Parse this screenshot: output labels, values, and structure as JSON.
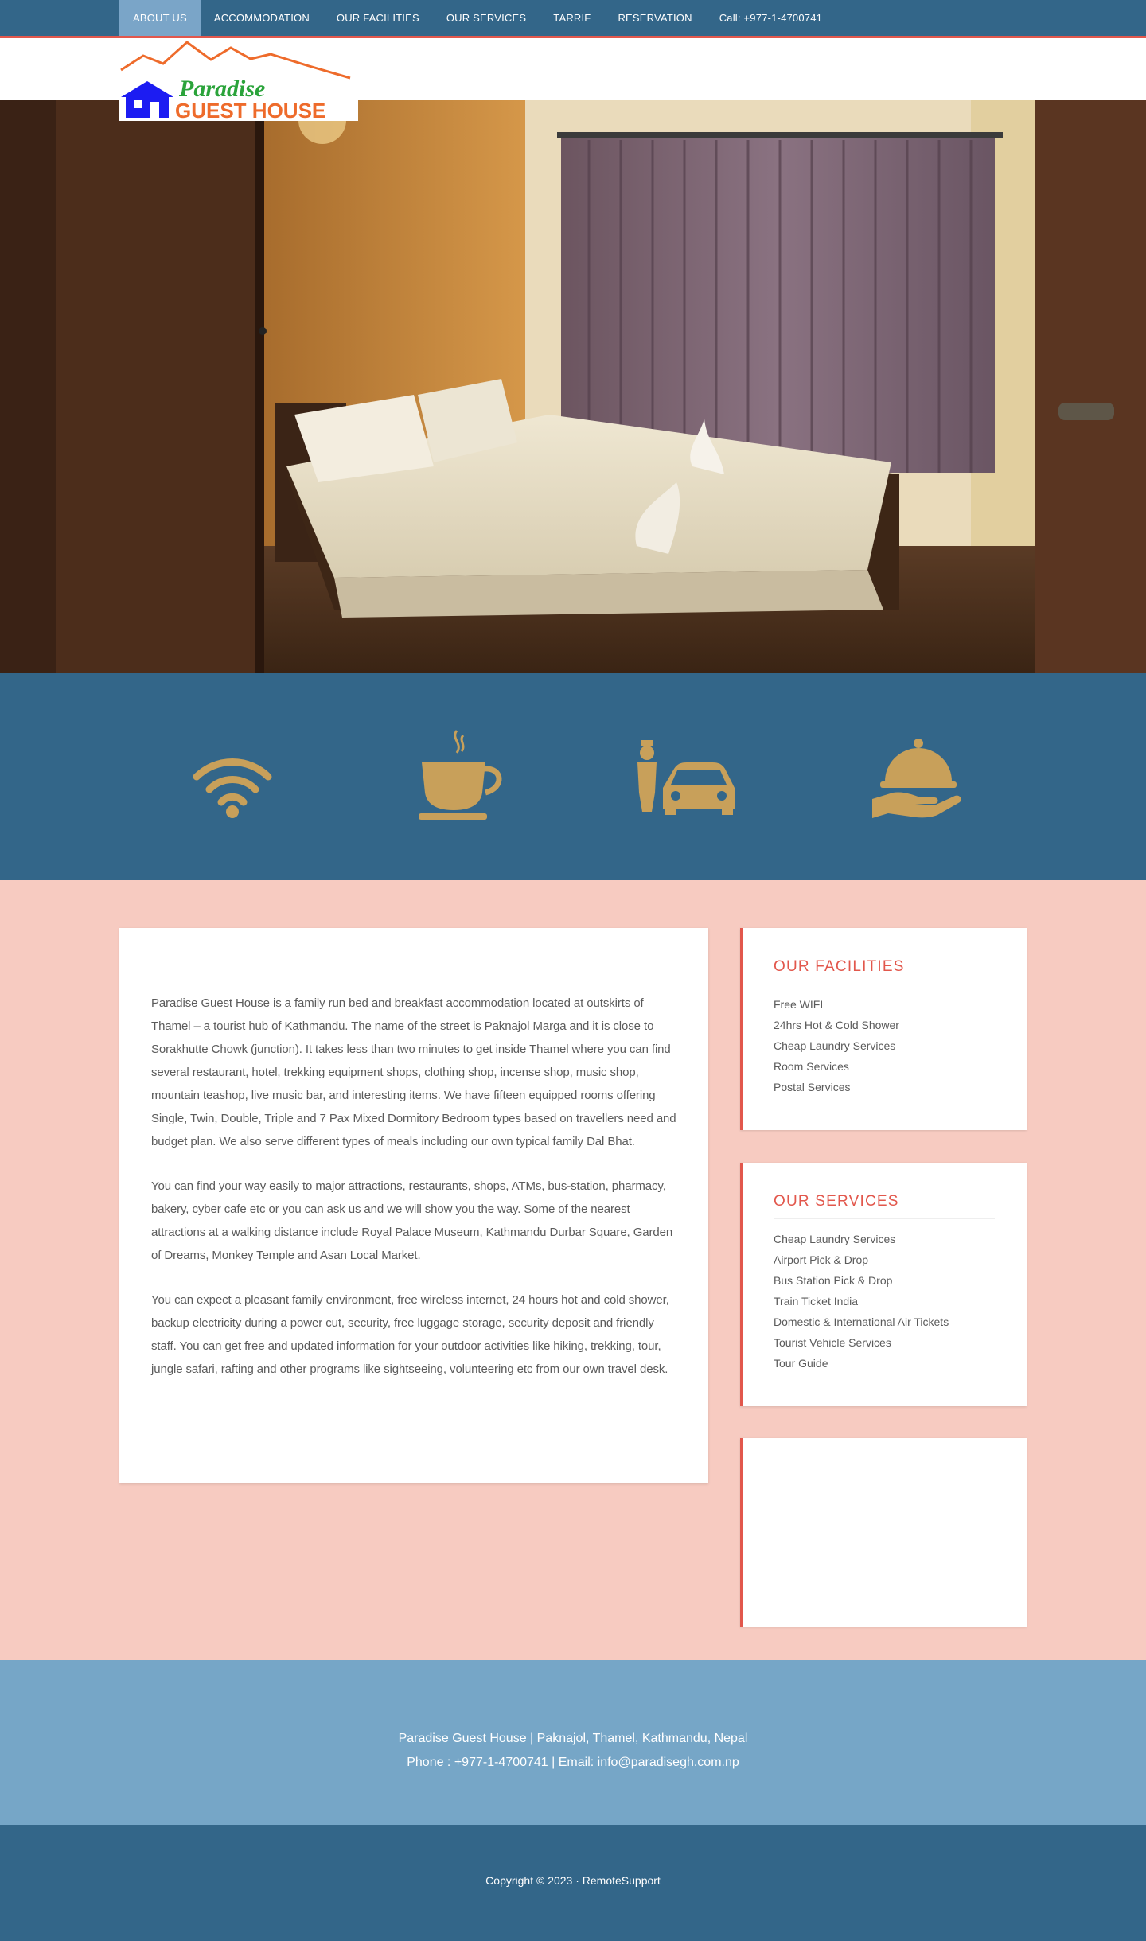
{
  "nav": {
    "items": [
      {
        "label": "ABOUT US",
        "active": true
      },
      {
        "label": "ACCOMMODATION",
        "active": false
      },
      {
        "label": "OUR FACILITIES",
        "active": false
      },
      {
        "label": "OUR SERVICES",
        "active": false
      },
      {
        "label": "TARRIF",
        "active": false
      },
      {
        "label": "RESERVATION",
        "active": false
      },
      {
        "label": "Call: +977-1-4700741",
        "active": false
      }
    ]
  },
  "logo": {
    "line1": "Paradise",
    "line2": "GUEST HOUSE"
  },
  "features": [
    {
      "icon": "wifi-icon"
    },
    {
      "icon": "coffee-cup-icon"
    },
    {
      "icon": "bellboy-car-icon"
    },
    {
      "icon": "room-service-icon"
    }
  ],
  "about": {
    "paragraphs": [
      "Paradise Guest House is a family run bed and breakfast accommodation located at outskirts of Thamel – a tourist hub of Kathmandu. The name of the street is Paknajol Marga and it is close to Sorakhutte Chowk (junction). It takes less than two minutes to get inside Thamel where you can find several restaurant, hotel, trekking equipment shops, clothing shop, incense shop, music shop, mountain teashop, live music bar, and interesting items. We have fifteen equipped rooms offering Single, Twin, Double, Triple and 7 Pax Mixed Dormitory Bedroom types based on travellers need and budget plan. We also serve different types of meals including our own typical family Dal Bhat.",
      "You can find your way easily to major attractions, restaurants, shops, ATMs, bus-station, pharmacy, bakery, cyber cafe etc or you can ask us and we will show you the way. Some of the nearest attractions at a walking distance include Royal Palace Museum, Kathmandu Durbar Square, Garden of Dreams, Monkey Temple and Asan Local Market.",
      "You can expect a pleasant family environment, free wireless internet, 24 hours hot and cold shower, backup electricity during a power cut, security, free luggage storage, security deposit and friendly staff. You can get free and updated information for your outdoor activities like hiking, trekking, tour, jungle safari, rafting and other programs like sightseeing, volunteering etc from our own travel desk."
    ]
  },
  "facilities": {
    "title": "OUR FACILITIES",
    "items": [
      "Free WIFI",
      "24hrs Hot & Cold Shower",
      "Cheap Laundry Services",
      "Room Services",
      "Postal Services"
    ]
  },
  "services": {
    "title": "OUR SERVICES",
    "items": [
      "Cheap Laundry Services",
      "Airport Pick & Drop",
      "Bus Station Pick & Drop",
      "Train Ticket India",
      "Domestic & International Air Tickets",
      "Tourist Vehicle Services",
      "Tour Guide"
    ]
  },
  "footer": {
    "line1": "Paradise Guest House | Paknajol, Thamel, Kathmandu, Nepal",
    "line2": "Phone : +977-1-4700741 | Email: info@paradisegh.com.np",
    "copyright": "Copyright © 2023 · RemoteSupport"
  },
  "colors": {
    "nav_bg": "#336689",
    "nav_active": "#7aa5c8",
    "accent": "#e2574c",
    "icon_gold": "#c8a05a",
    "page_bg": "#f7cbc1",
    "footer_light": "#76a6c7"
  }
}
